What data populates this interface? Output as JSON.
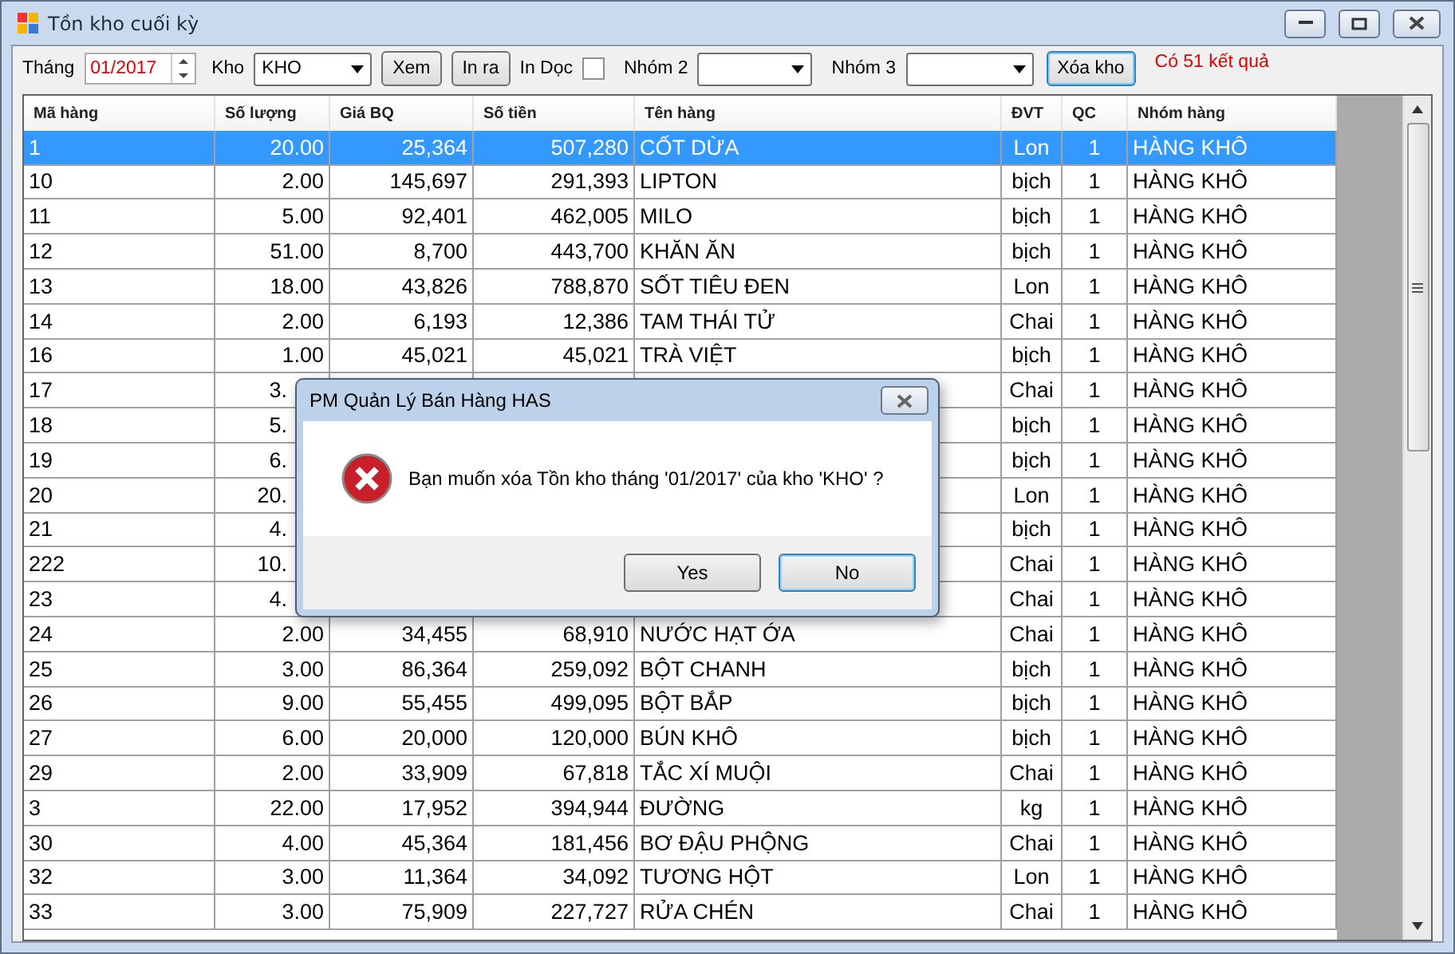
{
  "window": {
    "title": "Tồn kho cuối kỳ"
  },
  "toolbar": {
    "month_label": "Tháng",
    "month_value": "01/2017",
    "store_label": "Kho",
    "store_value": "KHO",
    "view_button": "Xem",
    "print_button": "In ra",
    "portrait_label": "In Dọc",
    "portrait_checked": false,
    "group2_label": "Nhóm 2",
    "group3_label": "Nhóm 3",
    "delete_button": "Xóa kho",
    "result": "Có 51 kết quả"
  },
  "table": {
    "columns": [
      "Mã hàng",
      "Số lượng",
      "Giá BQ",
      "Số tiền",
      "Tên hàng",
      "ĐVT",
      "QC",
      "Nhóm hàng"
    ],
    "rows": [
      {
        "selected": true,
        "cells": [
          "1",
          "20.00",
          "25,364",
          "507,280",
          "CỐT DỪA",
          "Lon",
          "1",
          "HÀNG KHÔ"
        ]
      },
      {
        "selected": false,
        "cells": [
          "10",
          "2.00",
          "145,697",
          "291,393",
          "LIPTON",
          "bịch",
          "1",
          "HÀNG KHÔ"
        ]
      },
      {
        "selected": false,
        "cells": [
          "11",
          "5.00",
          "92,401",
          "462,005",
          "MILO",
          "bịch",
          "1",
          "HÀNG KHÔ"
        ]
      },
      {
        "selected": false,
        "cells": [
          "12",
          "51.00",
          "8,700",
          "443,700",
          "KHĂN ĂN",
          "bịch",
          "1",
          "HÀNG KHÔ"
        ]
      },
      {
        "selected": false,
        "cells": [
          "13",
          "18.00",
          "43,826",
          "788,870",
          "SỐT TIÊU ĐEN",
          "Lon",
          "1",
          "HÀNG KHÔ"
        ]
      },
      {
        "selected": false,
        "cells": [
          "14",
          "2.00",
          "6,193",
          "12,386",
          "TAM THÁI TỬ",
          "Chai",
          "1",
          "HÀNG KHÔ"
        ]
      },
      {
        "selected": false,
        "cells": [
          "16",
          "1.00",
          "45,021",
          "45,021",
          "TRÀ VIỆT",
          "bịch",
          "1",
          "HÀNG KHÔ"
        ]
      },
      {
        "selected": false,
        "cells": [
          "17",
          "3.",
          null,
          null,
          null,
          "Chai",
          "1",
          "HÀNG KHÔ"
        ]
      },
      {
        "selected": false,
        "cells": [
          "18",
          "5.",
          null,
          null,
          null,
          "bịch",
          "1",
          "HÀNG KHÔ"
        ]
      },
      {
        "selected": false,
        "cells": [
          "19",
          "6.",
          null,
          null,
          null,
          "bịch",
          "1",
          "HÀNG KHÔ"
        ]
      },
      {
        "selected": false,
        "cells": [
          "20",
          "20.",
          null,
          null,
          null,
          "Lon",
          "1",
          "HÀNG KHÔ"
        ]
      },
      {
        "selected": false,
        "cells": [
          "21",
          "4.",
          null,
          null,
          null,
          "bịch",
          "1",
          "HÀNG KHÔ"
        ]
      },
      {
        "selected": false,
        "cells": [
          "222",
          "10.",
          null,
          null,
          null,
          "Chai",
          "1",
          "HÀNG KHÔ"
        ]
      },
      {
        "selected": false,
        "cells": [
          "23",
          "4.",
          null,
          null,
          null,
          "Chai",
          "1",
          "HÀNG KHÔ"
        ]
      },
      {
        "selected": false,
        "cells": [
          "24",
          "2.00",
          "34,455",
          "68,910",
          "NƯỚC HẠT ỚA",
          "Chai",
          "1",
          "HÀNG KHÔ"
        ]
      },
      {
        "selected": false,
        "cells": [
          "25",
          "3.00",
          "86,364",
          "259,092",
          "BỘT CHANH",
          "bịch",
          "1",
          "HÀNG KHÔ"
        ]
      },
      {
        "selected": false,
        "cells": [
          "26",
          "9.00",
          "55,455",
          "499,095",
          "BỘT BẮP",
          "bịch",
          "1",
          "HÀNG KHÔ"
        ]
      },
      {
        "selected": false,
        "cells": [
          "27",
          "6.00",
          "20,000",
          "120,000",
          "BÚN KHÔ",
          "bịch",
          "1",
          "HÀNG KHÔ"
        ]
      },
      {
        "selected": false,
        "cells": [
          "29",
          "2.00",
          "33,909",
          "67,818",
          "TẮC XÍ MUỘI",
          "Chai",
          "1",
          "HÀNG KHÔ"
        ]
      },
      {
        "selected": false,
        "cells": [
          "3",
          "22.00",
          "17,952",
          "394,944",
          "ĐƯỜNG",
          "kg",
          "1",
          "HÀNG KHÔ"
        ]
      },
      {
        "selected": false,
        "cells": [
          "30",
          "4.00",
          "45,364",
          "181,456",
          "BƠ ĐẬU PHỘNG",
          "Chai",
          "1",
          "HÀNG KHÔ"
        ]
      },
      {
        "selected": false,
        "cells": [
          "32",
          "3.00",
          "11,364",
          "34,092",
          "TƯƠNG HỘT",
          "Lon",
          "1",
          "HÀNG KHÔ"
        ]
      },
      {
        "selected": false,
        "cells": [
          "33",
          "3.00",
          "75,909",
          "227,727",
          "RỬA CHÉN",
          "Chai",
          "1",
          "HÀNG KHÔ"
        ]
      }
    ]
  },
  "dialog": {
    "title": "PM Quản Lý Bán Hàng HAS",
    "message": "Bạn muốn xóa Tồn kho tháng '01/2017' của kho 'KHO' ?",
    "buttons": [
      {
        "label": "Yes",
        "focused": false
      },
      {
        "label": "No",
        "focused": true
      }
    ]
  }
}
